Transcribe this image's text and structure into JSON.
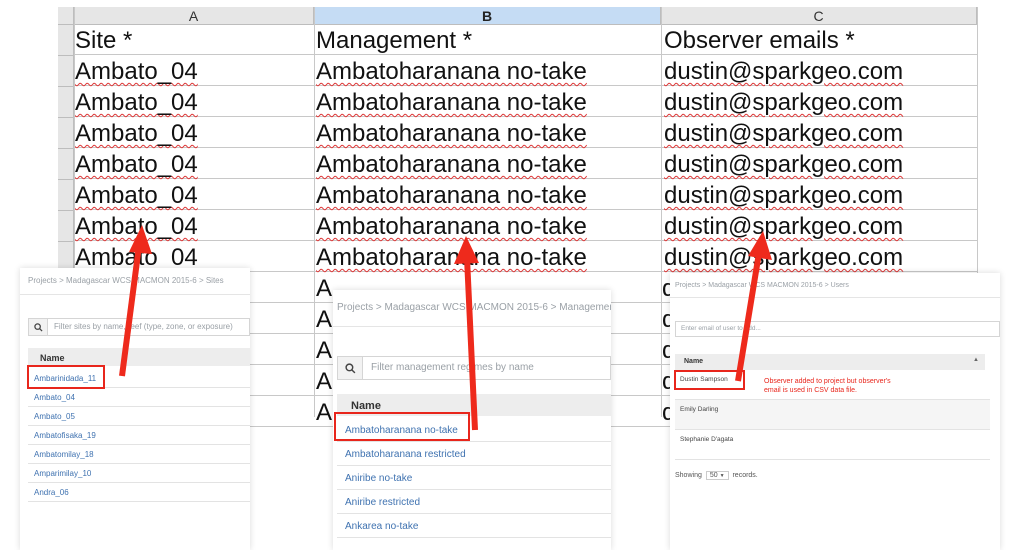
{
  "spreadsheet": {
    "columns": [
      {
        "letter": "A",
        "header": "Site *"
      },
      {
        "letter": "B",
        "header": "Management *"
      },
      {
        "letter": "C",
        "header": "Observer emails *"
      }
    ],
    "rows": [
      [
        "Ambato_04",
        "Ambatoharanana no-take",
        "dustin@sparkgeo.com"
      ],
      [
        "Ambato_04",
        "Ambatoharanana no-take",
        "dustin@sparkgeo.com"
      ],
      [
        "Ambato_04",
        "Ambatoharanana no-take",
        "dustin@sparkgeo.com"
      ],
      [
        "Ambato_04",
        "Ambatoharanana no-take",
        "dustin@sparkgeo.com"
      ],
      [
        "Ambato_04",
        "Ambatoharanana no-take",
        "dustin@sparkgeo.com"
      ],
      [
        "Ambato_04",
        "Ambatoharanana no-take",
        "dustin@sparkgeo.com"
      ],
      [
        "Ambato_04",
        "Ambatoharanana no-take",
        "dustin@sparkgeo.com"
      ]
    ],
    "clipped_b": [
      "A",
      "A",
      "A",
      "A",
      "A"
    ],
    "clipped_c": [
      "d",
      "d",
      "d",
      "d",
      "d"
    ]
  },
  "sites_panel": {
    "breadcrumb": "Projects > Madagascar WCS MACMON 2015-6 > Sites",
    "filter_placeholder": "Filter sites by name, reef (type, zone, or exposure)",
    "column_name": "Name",
    "items": [
      "Ambarinidada_11",
      "Ambato_04",
      "Ambato_05",
      "Ambatofisaka_19",
      "Ambatomilay_18",
      "Amparimilay_10",
      "Andra_06"
    ]
  },
  "management_panel": {
    "breadcrumb": "Projects > Madagascar WCS MACMON 2015-6 > Management",
    "filter_placeholder": "Filter management regimes by name",
    "column_name": "Name",
    "items": [
      "Ambatoharanana no-take",
      "Ambatoharanana restricted",
      "Aniribe no-take",
      "Aniribe restricted",
      "Ankarea no-take"
    ]
  },
  "users_panel": {
    "breadcrumb": "Projects > Madagascar WCS MACMON 2015-6 > Users",
    "email_placeholder": "Enter email of user to add...",
    "column_name": "Name",
    "items": [
      "Dustin Sampson",
      "Emily Darling",
      "Stephanie D'agata"
    ],
    "note": "Observer added to project but observer's email is used in CSV data file.",
    "showing_label": "Showing",
    "page_size": "50",
    "records_label": "records."
  },
  "colors": {
    "highlight": "#e8261c",
    "link": "#3f72b0",
    "selected_col": "#c5dcf4"
  },
  "icons": [
    "search-icon",
    "sort-icon",
    "arrow-annotation"
  ]
}
